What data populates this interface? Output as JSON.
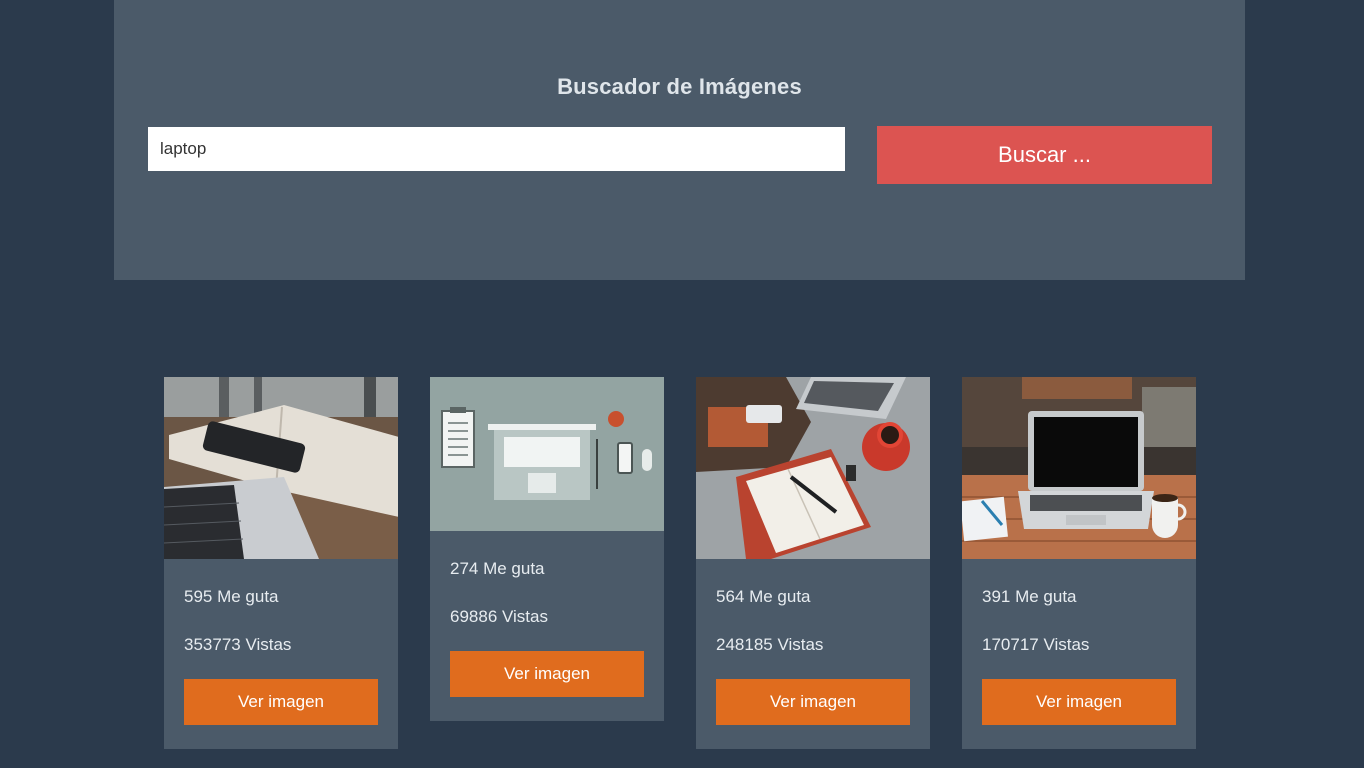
{
  "header": {
    "title": "Buscador de Imágenes",
    "search_value": "laptop",
    "search_button_label": "Buscar ..."
  },
  "colors": {
    "background": "#2b3a4c",
    "panel": "#4b5a69",
    "search_button": "#dc5451",
    "card_button": "#e06c1e"
  },
  "results": [
    {
      "likes": "595 Me guta",
      "views": "353773 Vistas",
      "button_label": "Ver imagen"
    },
    {
      "likes": "274 Me guta",
      "views": "69886 Vistas",
      "button_label": "Ver imagen"
    },
    {
      "likes": "564 Me guta",
      "views": "248185 Vistas",
      "button_label": "Ver imagen"
    },
    {
      "likes": "391 Me guta",
      "views": "170717 Vistas",
      "button_label": "Ver imagen"
    }
  ]
}
